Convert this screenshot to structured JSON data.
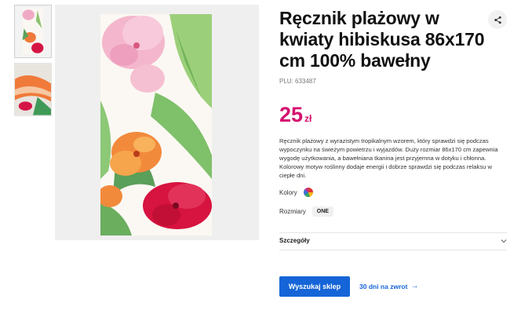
{
  "product": {
    "title": "Ręcznik plażowy w kwiaty hibiskusa 86x170 cm 100% bawełny",
    "plu": "PLU: 633487",
    "price_amount": "25",
    "price_currency": "zł",
    "description": "Ręcznik plażowy z wyrazistym tropikalnym wzorem, który sprawdzi się podczas wypoczynku na świeżym powietrzu i wyjazdów. Duży rozmiar 86x170 cm zapewnia wygodę użytkowania, a bawełniana tkanina jest przyjemna w dotyku i chłonna. Kolorowy motyw roślinny dodaje energii i dobrze sprawdzi się podczas relaksu w ciepłe dni."
  },
  "options": {
    "colors_label": "Kolory",
    "sizes_label": "Rozmiary",
    "size_value": "ONE"
  },
  "details": {
    "label": "Szczegóły"
  },
  "actions": {
    "find_store": "Wyszukaj sklep",
    "returns": "30 dni na zwrot",
    "returns_arrow": "→"
  },
  "icons": {
    "share": "share-icon",
    "chevron": "chevron-down-icon",
    "color_swatch": "multicolor-swatch"
  },
  "colors": {
    "accent_price": "#d4106f",
    "primary_button": "#1565d8"
  }
}
